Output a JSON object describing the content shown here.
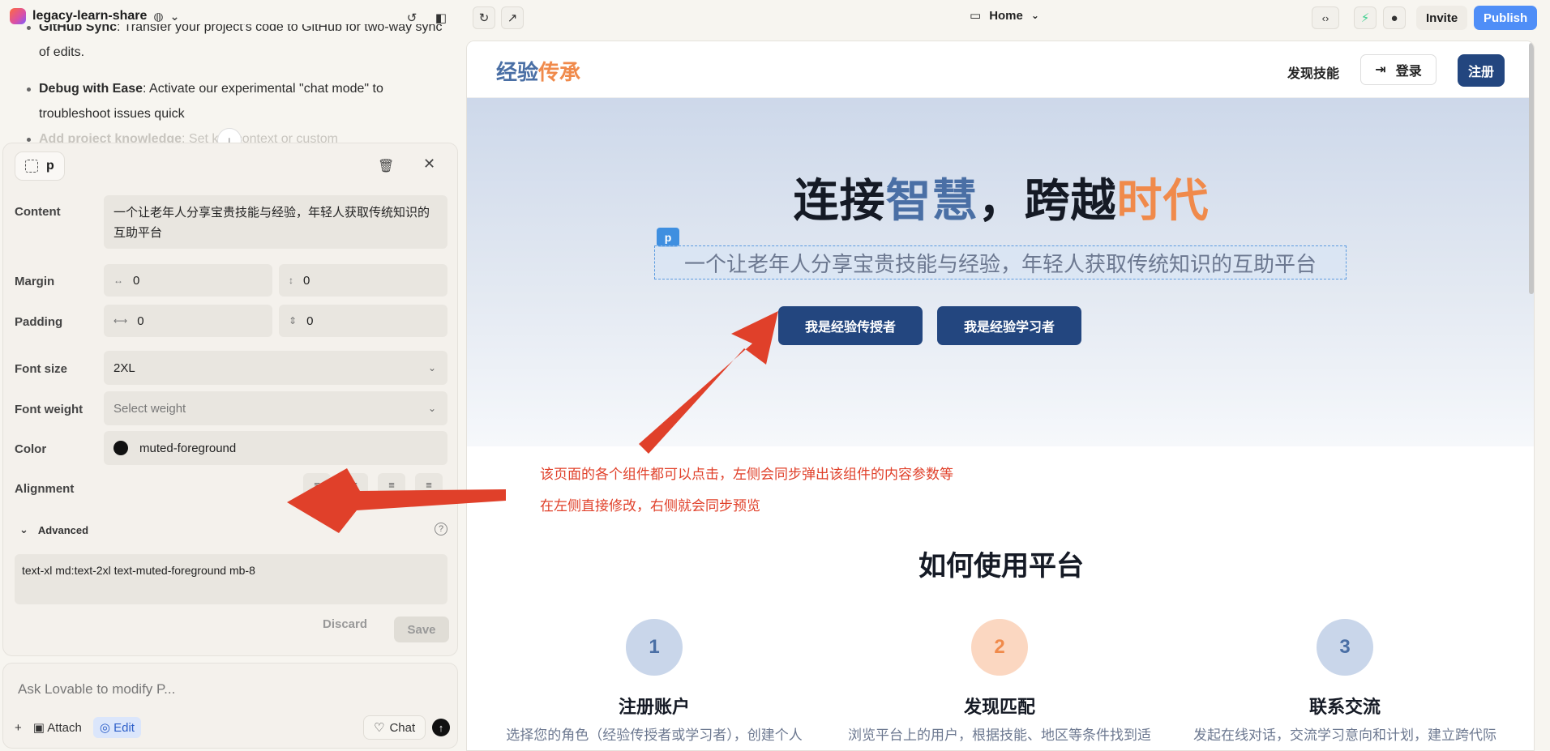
{
  "topbar": {
    "project_name": "legacy-learn-share",
    "page_selector": "Home",
    "invite_label": "Invite",
    "publish_label": "Publish"
  },
  "chat": {
    "bullets": [
      {
        "bold": "GitHub Sync",
        "text": ": Transfer your project's code to GitHub for two-way sync of edits."
      },
      {
        "bold": "Debug with Ease",
        "text": ": Activate our experimental \"chat mode\" to troubleshoot issues quick"
      },
      {
        "bold": "Add project knowledge",
        "text": ": Set key context or custom"
      }
    ]
  },
  "panel": {
    "element_tag": "p",
    "content_label": "Content",
    "content_value": "一个让老年人分享宝贵技能与经验，年轻人获取传统知识的互助平台",
    "margin_label": "Margin",
    "margin_x": "0",
    "margin_y": "0",
    "padding_label": "Padding",
    "padding_x": "0",
    "padding_y": "0",
    "font_size_label": "Font size",
    "font_size_value": "2XL",
    "font_weight_label": "Font weight",
    "font_weight_placeholder": "Select weight",
    "color_label": "Color",
    "color_value": "muted-foreground",
    "alignment_label": "Alignment",
    "advanced_label": "Advanced",
    "classes_value": "text-xl md:text-2xl text-muted-foreground mb-8",
    "discard_label": "Discard",
    "save_label": "Save"
  },
  "ask": {
    "placeholder": "Ask Lovable to modify P...",
    "attach_label": "Attach",
    "edit_label": "Edit",
    "chat_label": "Chat"
  },
  "site": {
    "brand_part1": "经验",
    "brand_part2": "传承",
    "nav_discover": "发现技能",
    "nav_login": "登录",
    "nav_register": "注册",
    "hero_title_a": "连接",
    "hero_title_b": "智慧",
    "hero_title_c": "，跨越",
    "hero_title_d": "时代",
    "selected_tag": "p",
    "hero_subtitle": "一个让老年人分享宝贵技能与经验，年轻人获取传统知识的互助平台",
    "btn_teacher": "我是经验传授者",
    "btn_learner": "我是经验学习者",
    "how_title": "如何使用平台",
    "steps": [
      {
        "num": "1",
        "title": "注册账户",
        "desc": "选择您的角色（经验传授者或学习者），创建个人"
      },
      {
        "num": "2",
        "title": "发现匹配",
        "desc": "浏览平台上的用户，根据技能、地区等条件找到适"
      },
      {
        "num": "3",
        "title": "联系交流",
        "desc": "发起在线对话，交流学习意向和计划，建立跨代际"
      }
    ]
  },
  "annotations": {
    "line1": "该页面的各个组件都可以点击，左侧会同步弹出该组件的内容参数等",
    "line2": "在左侧直接修改，右侧就会同步预览"
  },
  "colors": {
    "accent_blue": "#4a6fa5",
    "accent_orange": "#f08a4b",
    "primary_button": "#23467f",
    "publish": "#4f8ef7",
    "annotation_red": "#e0402a"
  }
}
